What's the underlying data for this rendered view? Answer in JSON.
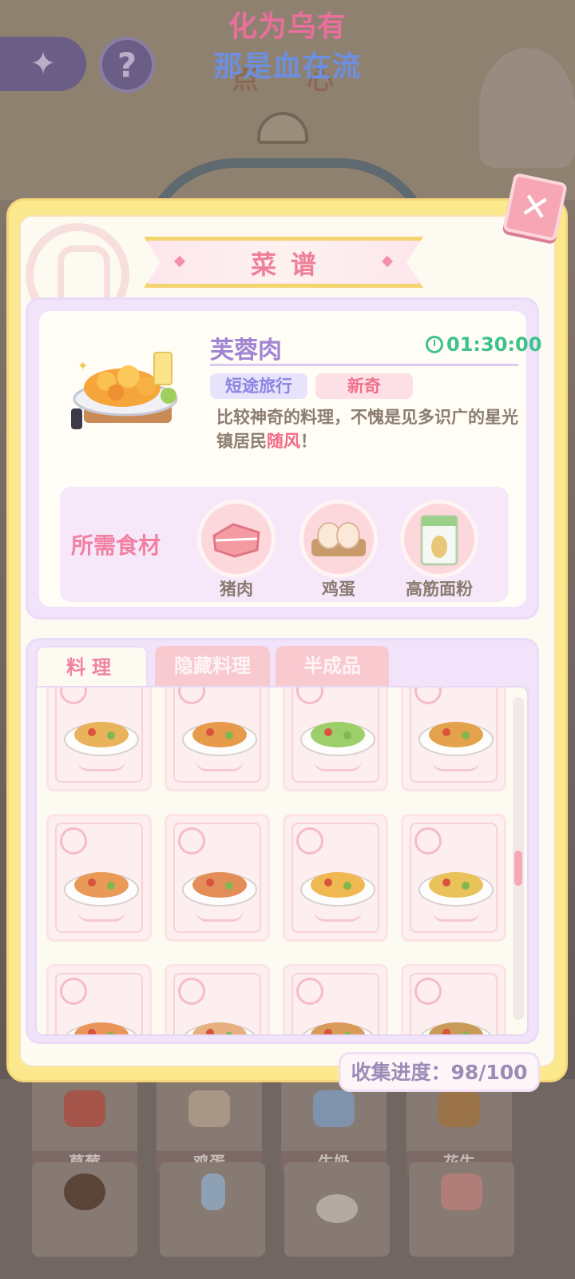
{
  "lyrics": {
    "line1": "化为乌有",
    "line2": "那是血在流"
  },
  "background": {
    "title": "点 心",
    "back_icon": "back-arrow-icon",
    "help_label": "?",
    "items": [
      {
        "label": "草莓",
        "color": "#c65a4e"
      },
      {
        "label": "鸡蛋",
        "color": "#bfa792"
      },
      {
        "label": "牛奶",
        "color": "#8fa4c0"
      },
      {
        "label": "花生",
        "color": "#b58550"
      }
    ]
  },
  "panel": {
    "title": "菜谱",
    "close_label": "✕",
    "selected": {
      "name": "芙蓉肉",
      "time": "01:30:00",
      "tags": [
        "短途旅行",
        "新奇"
      ],
      "desc_part1": "比较神奇的料理，不愧是见多识广的星光镇居民",
      "desc_highlight": "随风",
      "desc_part2": "！",
      "ingredients_title": "所需食材",
      "ingredients": [
        {
          "label": "猪肉",
          "icon": "pork-icon"
        },
        {
          "label": "鸡蛋",
          "icon": "egg-icon"
        },
        {
          "label": "高筋面粉",
          "icon": "flour-icon"
        }
      ]
    },
    "tabs": [
      "料理",
      "隐藏料理",
      "半成品"
    ],
    "recipes": [
      {
        "icon": "flatbread-icon",
        "color": "#e8b35a"
      },
      {
        "icon": "sushi-rolls-icon",
        "color": "#e69a4a"
      },
      {
        "icon": "wraps-icon",
        "color": "#9ccf6a"
      },
      {
        "icon": "hotdog-icon",
        "color": "#e5a24c"
      },
      {
        "icon": "pizza-icon",
        "color": "#e99a56"
      },
      {
        "icon": "pizza-icon",
        "color": "#e38e58"
      },
      {
        "icon": "fish-omelette-icon",
        "color": "#f0b850"
      },
      {
        "icon": "taco-icon",
        "color": "#e9c25a"
      },
      {
        "icon": "pizza-slice-icon",
        "color": "#e9955a"
      },
      {
        "icon": "dessert-plate-icon",
        "color": "#e6b080"
      },
      {
        "icon": "bun-icon",
        "color": "#d99a5a"
      },
      {
        "icon": "fish-icon",
        "color": "#c99a58"
      }
    ],
    "progress_label": "收集进度：98/100",
    "scroll_position": 0.5
  }
}
